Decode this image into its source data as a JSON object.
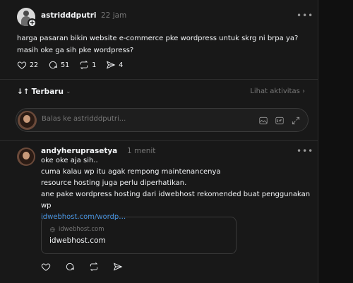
{
  "post": {
    "username": "astridddputri",
    "time": "22 jam",
    "text": "harga pasaran bikin website e-commerce pke wordpress untuk skrg ni brpa ya? masih oke ga sih pke wordpress?",
    "likes": "22",
    "comments": "51",
    "reposts": "1",
    "shares": "4",
    "more": "•••"
  },
  "sort": {
    "label": "Terbaru",
    "icon": "↓↑",
    "activity_link": "Lihat aktivitas ›"
  },
  "reply_box": {
    "placeholder": "Balas ke astridddputri..."
  },
  "reply": {
    "username": "andyheruprasetya",
    "time": "1 menit",
    "more": "•••",
    "lines": [
      "oke oke aja sih..",
      "cuma kalau wp itu agak rempong maintenancenya",
      "resource hosting juga perlu diperhatikan.",
      "ane pake wordpress hosting dari idwebhost rekomended buat penggunakan wp"
    ],
    "link": "idwebhost.com/wordp…",
    "preview": {
      "domain": "idwebhost.com",
      "title": "idwebhost.com"
    }
  }
}
